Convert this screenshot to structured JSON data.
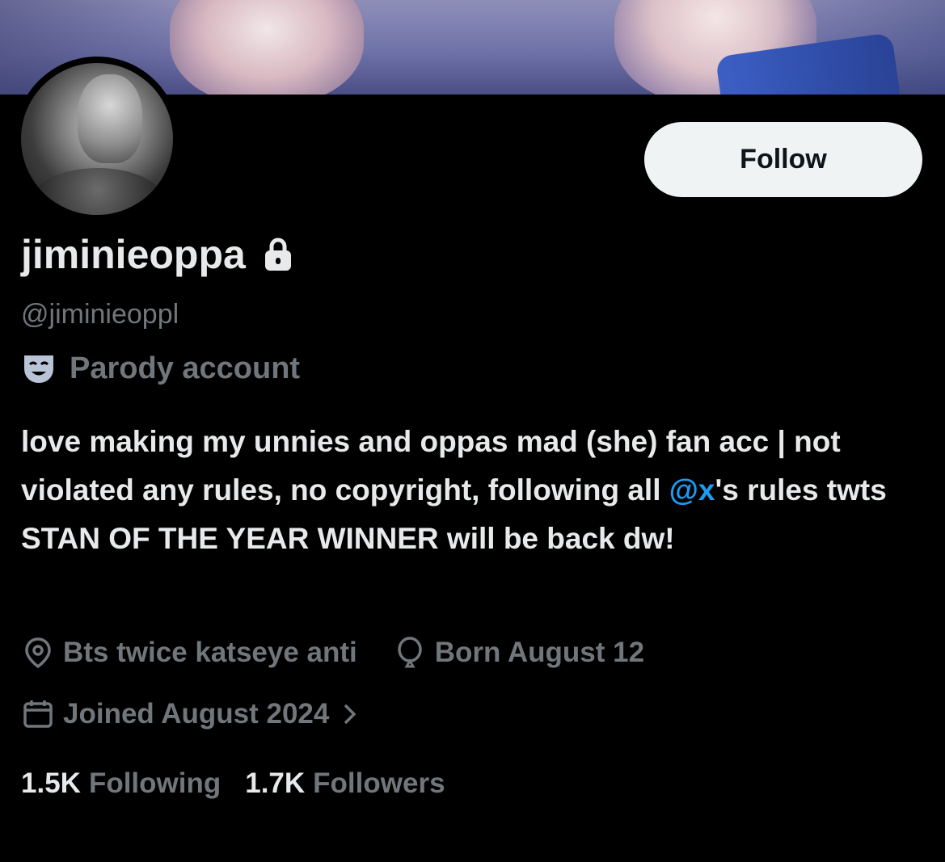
{
  "profile": {
    "display_name": "jiminieoppa",
    "handle": "@jiminieoppl",
    "label": "Parody account",
    "bio_part1": "love making my unnies and oppas mad (she) fan acc | not violated any rules, no copyright, following all ",
    "bio_mention": "@x",
    "bio_part2": "'s rules twts STAN OF THE YEAR WINNER will be back dw!",
    "location": "Bts twice katseye anti",
    "birthday": "Born August 12",
    "joined": "Joined August 2024",
    "following_count": "1.5K",
    "following_label": "Following",
    "followers_count": "1.7K",
    "followers_label": "Followers"
  },
  "actions": {
    "follow_label": "Follow"
  },
  "icons": {
    "lock": "lock-icon",
    "parody": "theater-mask-icon",
    "location": "location-pin-icon",
    "birthday": "balloon-icon",
    "joined": "calendar-icon",
    "chevron": "chevron-right-icon"
  },
  "colors": {
    "background": "#000000",
    "text_primary": "#e7e9ea",
    "text_secondary": "#71767b",
    "link": "#1d9bf0",
    "button_bg": "#eff3f4"
  }
}
